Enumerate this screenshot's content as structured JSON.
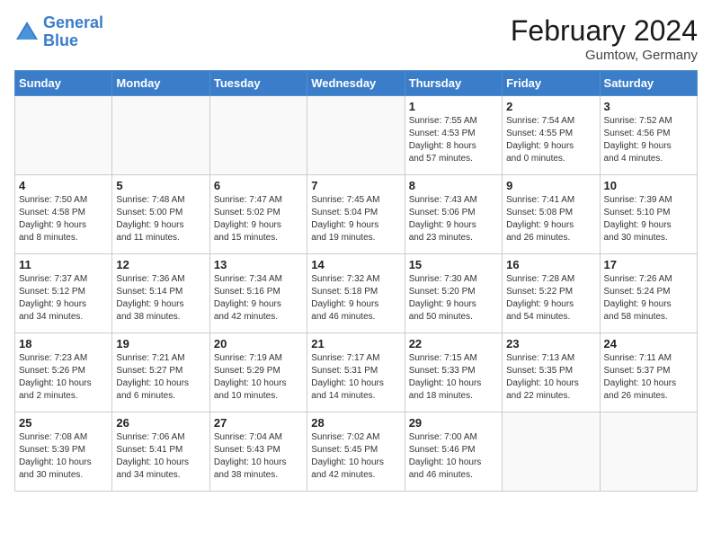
{
  "header": {
    "logo_text_1": "General",
    "logo_text_2": "Blue",
    "month": "February 2024",
    "location": "Gumtow, Germany"
  },
  "days_of_week": [
    "Sunday",
    "Monday",
    "Tuesday",
    "Wednesday",
    "Thursday",
    "Friday",
    "Saturday"
  ],
  "weeks": [
    [
      {
        "day": "",
        "info": ""
      },
      {
        "day": "",
        "info": ""
      },
      {
        "day": "",
        "info": ""
      },
      {
        "day": "",
        "info": ""
      },
      {
        "day": "1",
        "info": "Sunrise: 7:55 AM\nSunset: 4:53 PM\nDaylight: 8 hours\nand 57 minutes."
      },
      {
        "day": "2",
        "info": "Sunrise: 7:54 AM\nSunset: 4:55 PM\nDaylight: 9 hours\nand 0 minutes."
      },
      {
        "day": "3",
        "info": "Sunrise: 7:52 AM\nSunset: 4:56 PM\nDaylight: 9 hours\nand 4 minutes."
      }
    ],
    [
      {
        "day": "4",
        "info": "Sunrise: 7:50 AM\nSunset: 4:58 PM\nDaylight: 9 hours\nand 8 minutes."
      },
      {
        "day": "5",
        "info": "Sunrise: 7:48 AM\nSunset: 5:00 PM\nDaylight: 9 hours\nand 11 minutes."
      },
      {
        "day": "6",
        "info": "Sunrise: 7:47 AM\nSunset: 5:02 PM\nDaylight: 9 hours\nand 15 minutes."
      },
      {
        "day": "7",
        "info": "Sunrise: 7:45 AM\nSunset: 5:04 PM\nDaylight: 9 hours\nand 19 minutes."
      },
      {
        "day": "8",
        "info": "Sunrise: 7:43 AM\nSunset: 5:06 PM\nDaylight: 9 hours\nand 23 minutes."
      },
      {
        "day": "9",
        "info": "Sunrise: 7:41 AM\nSunset: 5:08 PM\nDaylight: 9 hours\nand 26 minutes."
      },
      {
        "day": "10",
        "info": "Sunrise: 7:39 AM\nSunset: 5:10 PM\nDaylight: 9 hours\nand 30 minutes."
      }
    ],
    [
      {
        "day": "11",
        "info": "Sunrise: 7:37 AM\nSunset: 5:12 PM\nDaylight: 9 hours\nand 34 minutes."
      },
      {
        "day": "12",
        "info": "Sunrise: 7:36 AM\nSunset: 5:14 PM\nDaylight: 9 hours\nand 38 minutes."
      },
      {
        "day": "13",
        "info": "Sunrise: 7:34 AM\nSunset: 5:16 PM\nDaylight: 9 hours\nand 42 minutes."
      },
      {
        "day": "14",
        "info": "Sunrise: 7:32 AM\nSunset: 5:18 PM\nDaylight: 9 hours\nand 46 minutes."
      },
      {
        "day": "15",
        "info": "Sunrise: 7:30 AM\nSunset: 5:20 PM\nDaylight: 9 hours\nand 50 minutes."
      },
      {
        "day": "16",
        "info": "Sunrise: 7:28 AM\nSunset: 5:22 PM\nDaylight: 9 hours\nand 54 minutes."
      },
      {
        "day": "17",
        "info": "Sunrise: 7:26 AM\nSunset: 5:24 PM\nDaylight: 9 hours\nand 58 minutes."
      }
    ],
    [
      {
        "day": "18",
        "info": "Sunrise: 7:23 AM\nSunset: 5:26 PM\nDaylight: 10 hours\nand 2 minutes."
      },
      {
        "day": "19",
        "info": "Sunrise: 7:21 AM\nSunset: 5:27 PM\nDaylight: 10 hours\nand 6 minutes."
      },
      {
        "day": "20",
        "info": "Sunrise: 7:19 AM\nSunset: 5:29 PM\nDaylight: 10 hours\nand 10 minutes."
      },
      {
        "day": "21",
        "info": "Sunrise: 7:17 AM\nSunset: 5:31 PM\nDaylight: 10 hours\nand 14 minutes."
      },
      {
        "day": "22",
        "info": "Sunrise: 7:15 AM\nSunset: 5:33 PM\nDaylight: 10 hours\nand 18 minutes."
      },
      {
        "day": "23",
        "info": "Sunrise: 7:13 AM\nSunset: 5:35 PM\nDaylight: 10 hours\nand 22 minutes."
      },
      {
        "day": "24",
        "info": "Sunrise: 7:11 AM\nSunset: 5:37 PM\nDaylight: 10 hours\nand 26 minutes."
      }
    ],
    [
      {
        "day": "25",
        "info": "Sunrise: 7:08 AM\nSunset: 5:39 PM\nDaylight: 10 hours\nand 30 minutes."
      },
      {
        "day": "26",
        "info": "Sunrise: 7:06 AM\nSunset: 5:41 PM\nDaylight: 10 hours\nand 34 minutes."
      },
      {
        "day": "27",
        "info": "Sunrise: 7:04 AM\nSunset: 5:43 PM\nDaylight: 10 hours\nand 38 minutes."
      },
      {
        "day": "28",
        "info": "Sunrise: 7:02 AM\nSunset: 5:45 PM\nDaylight: 10 hours\nand 42 minutes."
      },
      {
        "day": "29",
        "info": "Sunrise: 7:00 AM\nSunset: 5:46 PM\nDaylight: 10 hours\nand 46 minutes."
      },
      {
        "day": "",
        "info": ""
      },
      {
        "day": "",
        "info": ""
      }
    ]
  ]
}
